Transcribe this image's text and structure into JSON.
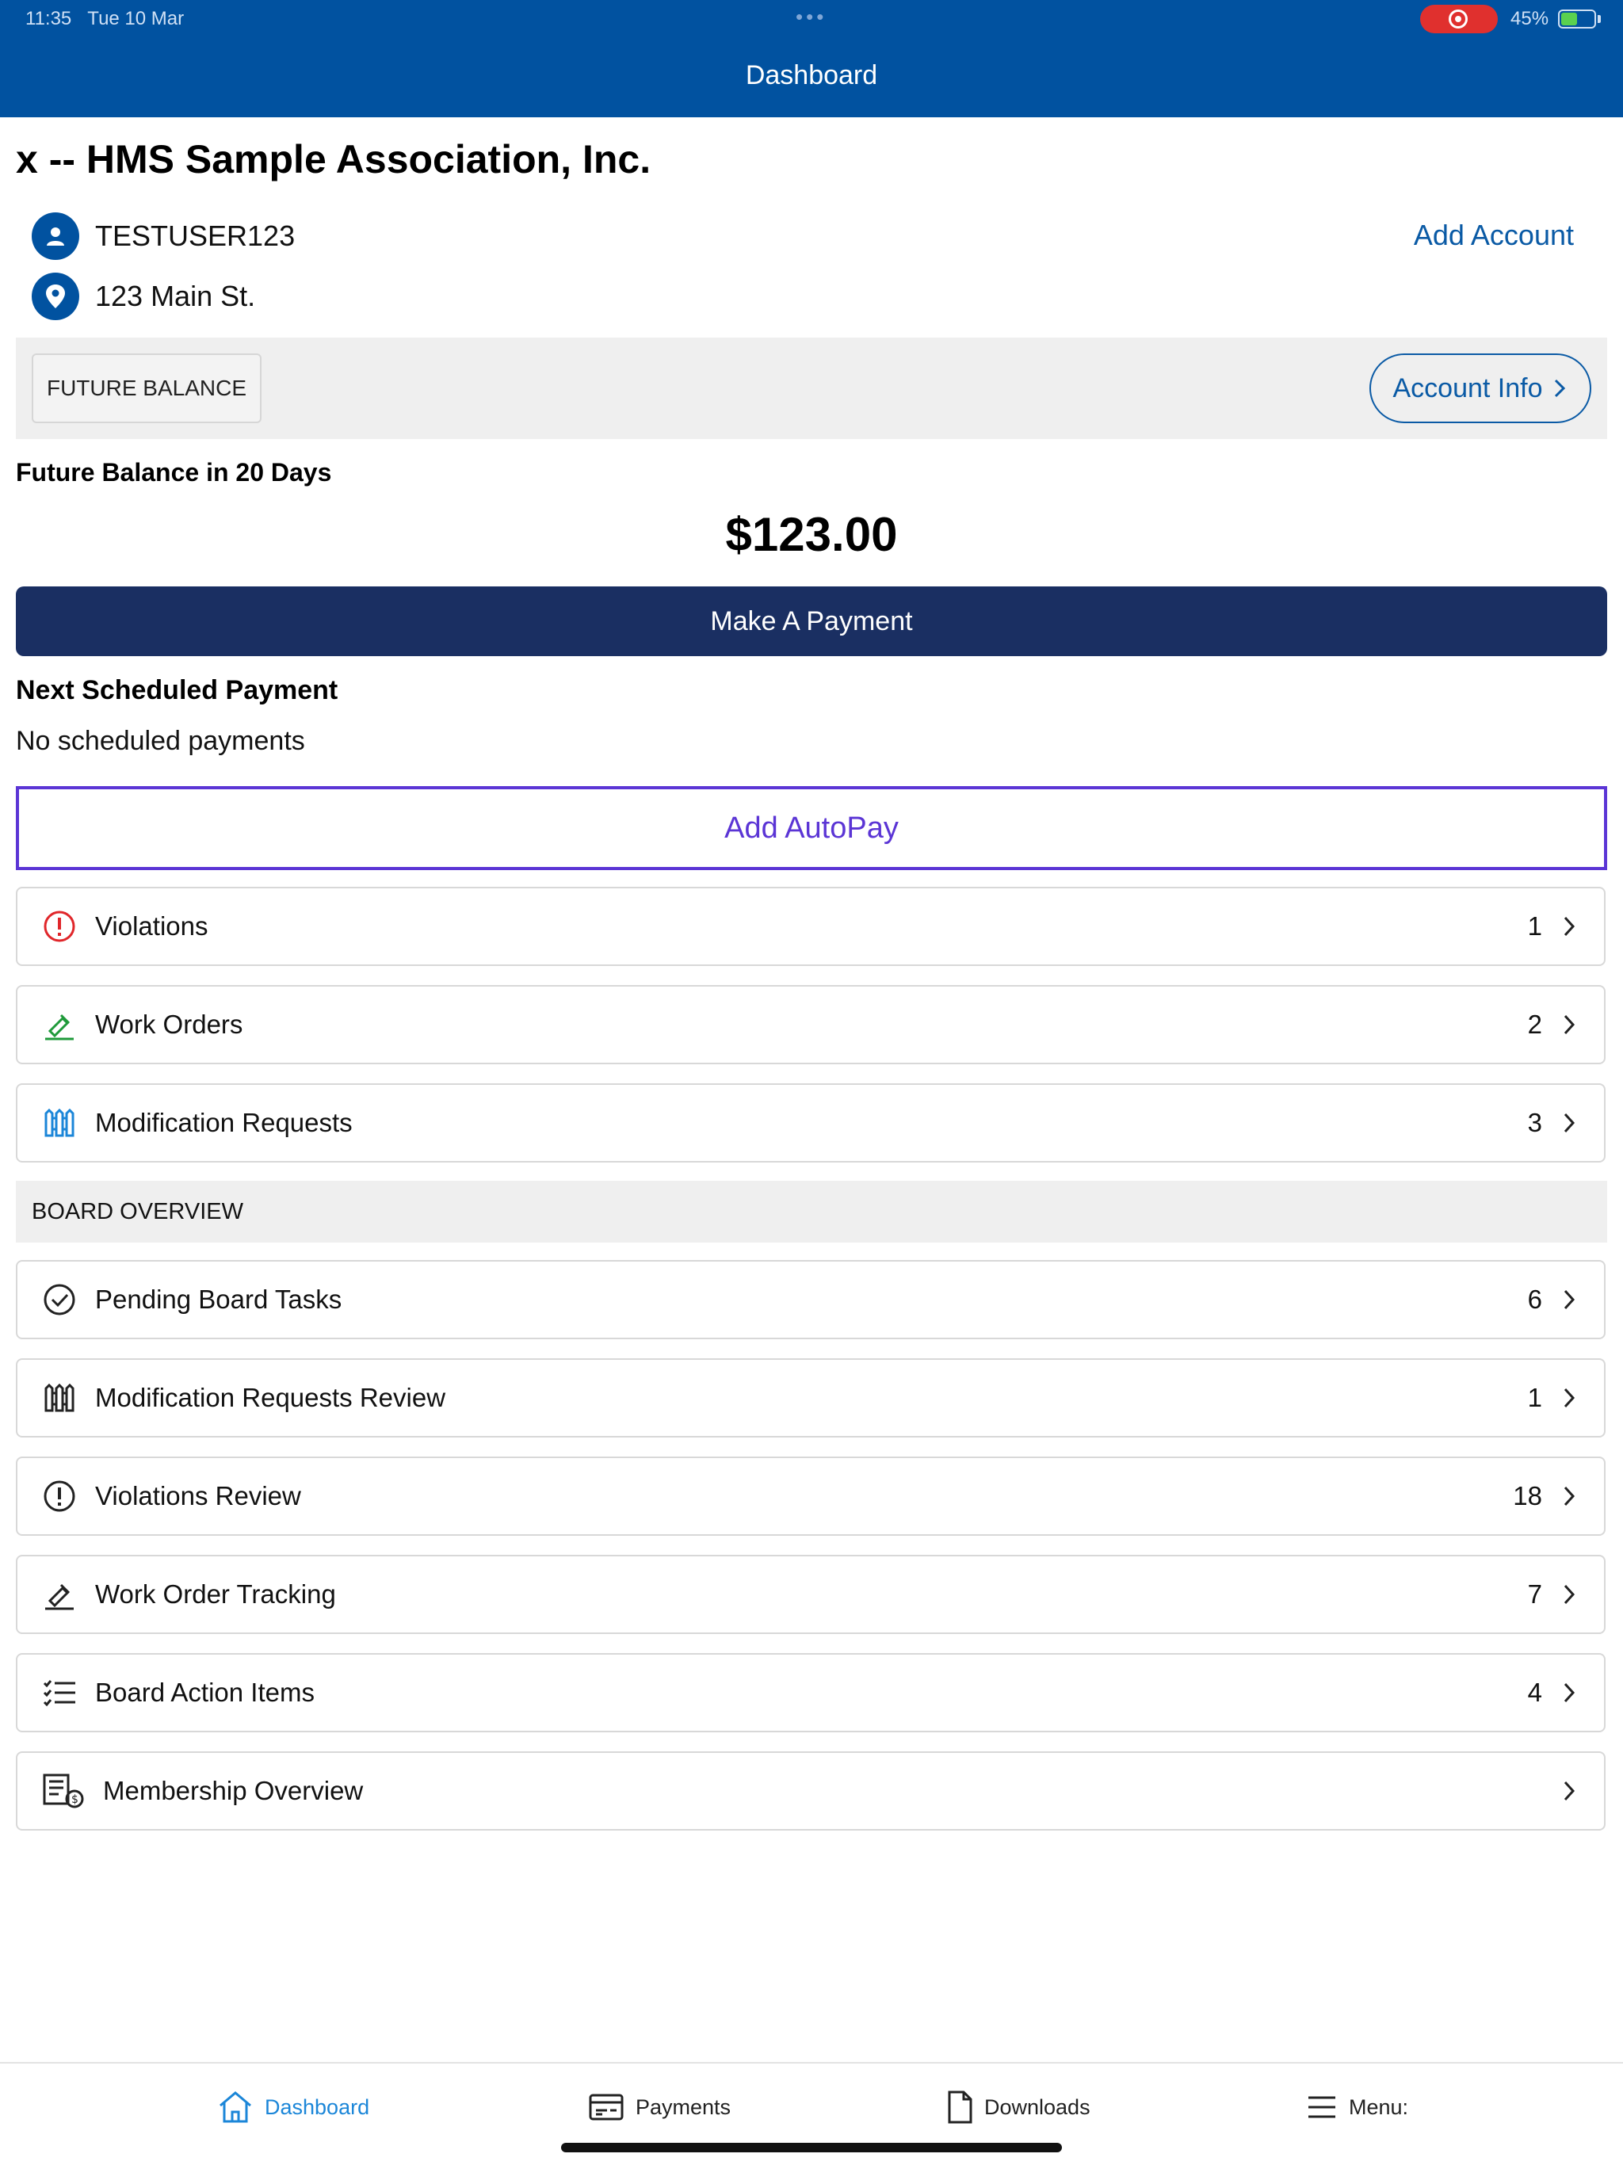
{
  "status_bar": {
    "time": "11:35",
    "date": "Tue 10 Mar",
    "battery": "45%",
    "battery_level": 0.45,
    "dots": "•••"
  },
  "nav": {
    "title": "Dashboard"
  },
  "account": {
    "org_name": "x -- HMS Sample Association, Inc.",
    "user": "TESTUSER123",
    "address": "123 Main St.",
    "add_account_label": "Add Account"
  },
  "balance": {
    "chip_label": "FUTURE BALANCE",
    "account_info_label": "Account Info",
    "label": "Future Balance in 20 Days",
    "amount": "$123.00",
    "pay_button": "Make A Payment"
  },
  "scheduled": {
    "label": "Next Scheduled Payment",
    "text": "No scheduled payments",
    "autopay_label": "Add AutoPay"
  },
  "owner_items": [
    {
      "label": "Violations",
      "count": "1",
      "icon": "alert-circle-icon",
      "color": "#e0262a"
    },
    {
      "label": "Work Orders",
      "count": "2",
      "icon": "hammer-icon",
      "color": "#1f9a3a"
    },
    {
      "label": "Modification Requests",
      "count": "3",
      "icon": "fence-icon",
      "color": "#1b86d8"
    }
  ],
  "board": {
    "section_label": "BOARD OVERVIEW",
    "items": [
      {
        "label": "Pending Board Tasks",
        "count": "6",
        "icon": "check-circle-icon"
      },
      {
        "label": "Modification Requests Review",
        "count": "1",
        "icon": "fence-icon"
      },
      {
        "label": "Violations Review",
        "count": "18",
        "icon": "alert-circle-icon"
      },
      {
        "label": "Work Order Tracking",
        "count": "7",
        "icon": "hammer-icon"
      },
      {
        "label": "Board Action Items",
        "count": "4",
        "icon": "checklist-icon"
      },
      {
        "label": "Membership Overview",
        "count": "",
        "icon": "ledger-dollar-icon"
      }
    ]
  },
  "tabs": [
    {
      "label": "Dashboard",
      "icon": "home-icon",
      "active": true
    },
    {
      "label": "Payments",
      "icon": "card-icon",
      "active": false
    },
    {
      "label": "Downloads",
      "icon": "document-icon",
      "active": false
    },
    {
      "label": "Menu:",
      "icon": "hamburger-icon",
      "active": false
    }
  ],
  "colors": {
    "nav_blue": "#0152a0",
    "pay_button": "#1a2f62",
    "autopay_purple": "#5b35d5",
    "link_blue": "#0a5aa5",
    "tab_active": "#1b86d8"
  }
}
